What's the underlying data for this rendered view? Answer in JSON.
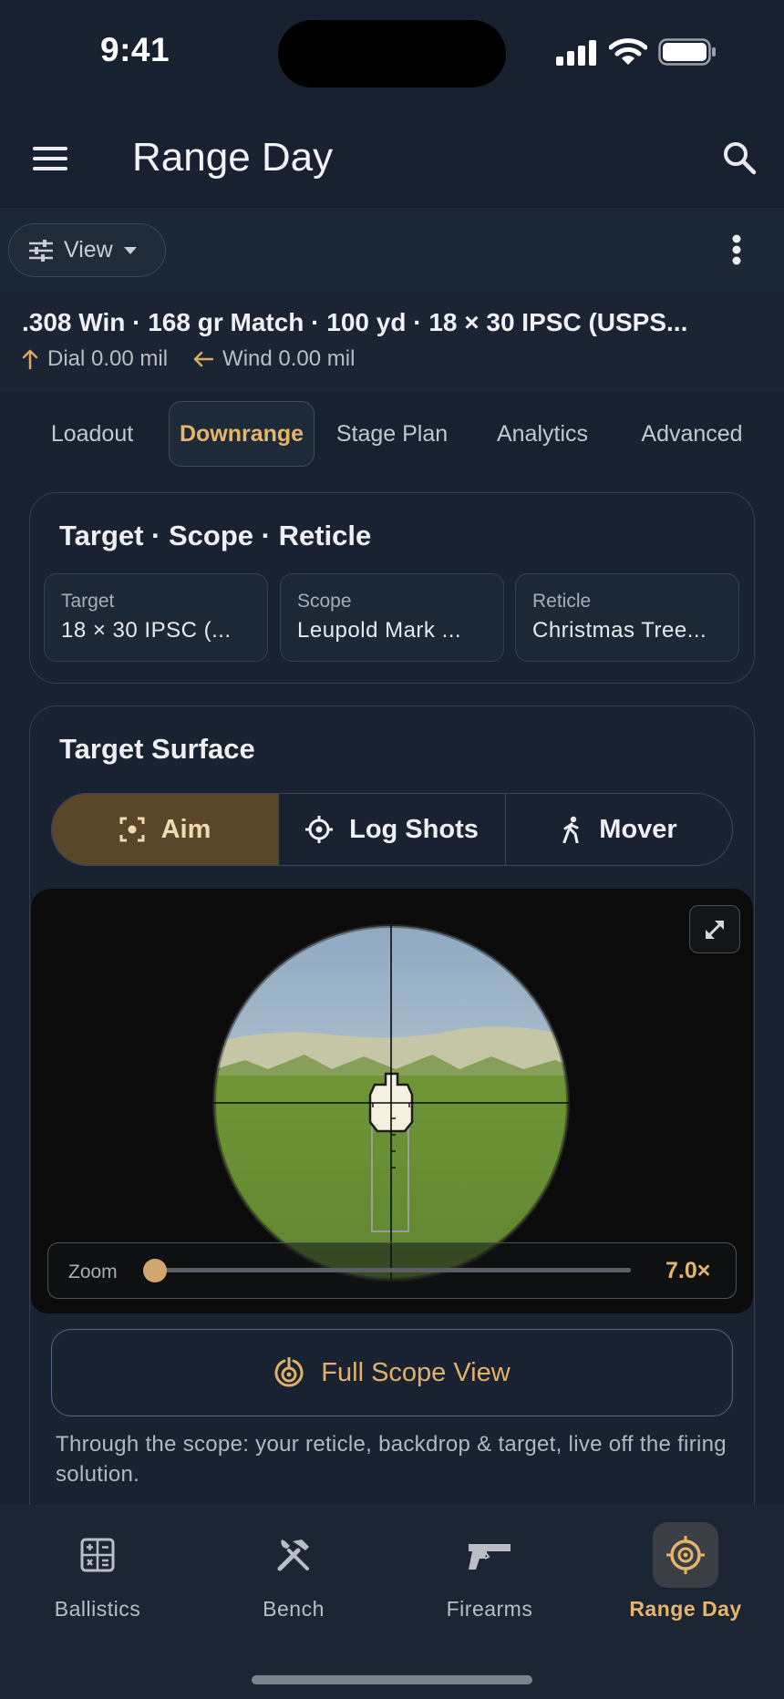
{
  "status_bar": {
    "time": "9:41"
  },
  "app_bar": {
    "title": "Range Day"
  },
  "view_chip": {
    "label": "View"
  },
  "summary": {
    "title": ".308 Win · 168 gr Match · 100 yd · 18 × 30 IPSC (USPS...",
    "dial": "Dial 0.00 mil",
    "wind": "Wind 0.00 mil"
  },
  "tabs": [
    {
      "label": "Loadout",
      "active": false
    },
    {
      "label": "Downrange",
      "active": true
    },
    {
      "label": "Stage Plan",
      "active": false
    },
    {
      "label": "Analytics",
      "active": false
    },
    {
      "label": "Advanced",
      "active": false
    }
  ],
  "tsr_card": {
    "title": "Target · Scope · Reticle",
    "items": [
      {
        "label": "Target",
        "value": "18 × 30 IPSC (..."
      },
      {
        "label": "Scope",
        "value": "Leupold Mark ..."
      },
      {
        "label": "Reticle",
        "value": "Christmas Tree..."
      }
    ]
  },
  "surface_card": {
    "title": "Target Surface",
    "modes": [
      {
        "label": "Aim",
        "icon": "aim-focus-icon",
        "active": true
      },
      {
        "label": "Log Shots",
        "icon": "crosshair-icon",
        "active": false
      },
      {
        "label": "Mover",
        "icon": "walking-person-icon",
        "active": false
      }
    ],
    "zoom": {
      "label": "Zoom",
      "value": "7.0×",
      "level": 0.0
    },
    "full_scope_button": "Full Scope View",
    "caption": "Through the scope: your reticle, backdrop & target, live off the firing solution."
  },
  "bottom_nav": [
    {
      "label": "Ballistics",
      "icon": "calculator-icon",
      "active": false
    },
    {
      "label": "Bench",
      "icon": "tools-icon",
      "active": false
    },
    {
      "label": "Firearms",
      "icon": "pistol-icon",
      "active": false
    },
    {
      "label": "Range Day",
      "icon": "target-icon",
      "active": true
    }
  ],
  "colors": {
    "background": "#172130",
    "accent": "#e6b46c",
    "active_segment": "#5a472a"
  }
}
